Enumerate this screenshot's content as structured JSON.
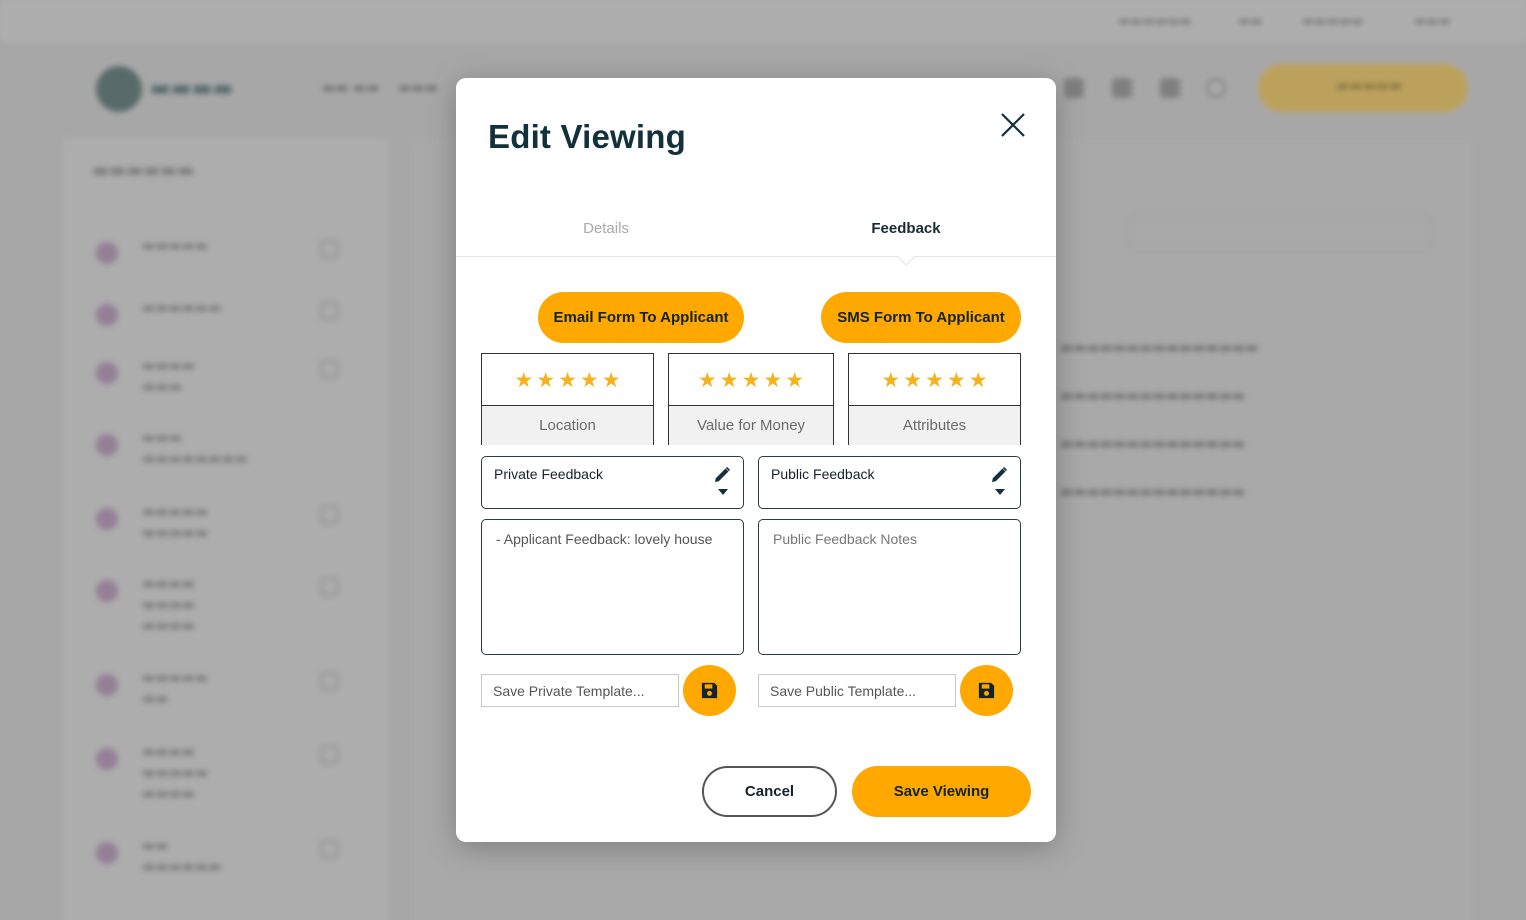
{
  "modal": {
    "title": "Edit Viewing",
    "tabs": [
      {
        "label": "Details",
        "active": false
      },
      {
        "label": "Feedback",
        "active": true
      }
    ],
    "actions": {
      "email_form": "Email Form To Applicant",
      "sms_form": "SMS Form To Applicant"
    },
    "ratings": [
      {
        "label": "Location",
        "stars": 5
      },
      {
        "label": "Value for Money",
        "stars": 5
      },
      {
        "label": "Attributes",
        "stars": 5
      }
    ],
    "private_feedback": {
      "label": "Private Feedback",
      "notes": "- Applicant Feedback: lovely house",
      "template_placeholder": "Save Private Template..."
    },
    "public_feedback": {
      "label": "Public Feedback",
      "notes_placeholder": "Public Feedback Notes",
      "template_placeholder": "Save Public Template..."
    },
    "footer": {
      "cancel": "Cancel",
      "save": "Save Viewing"
    }
  },
  "colors": {
    "accent": "#ffa800",
    "star": "#f6b21c",
    "title": "#12313d"
  },
  "icons": {
    "close": "close-icon",
    "edit": "pencil-icon",
    "dropdown": "caret-down-icon",
    "save": "floppy-disk-icon",
    "star": "star-icon"
  }
}
